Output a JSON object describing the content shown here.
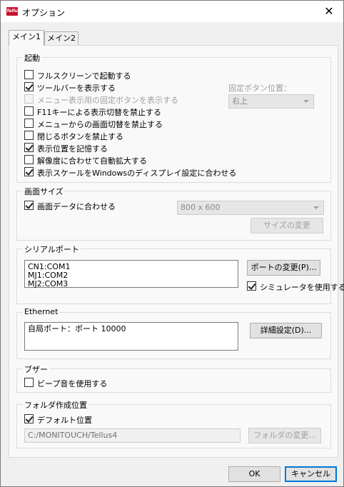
{
  "window": {
    "title": "オプション",
    "app_icon_text": "Tellus",
    "close_symbol": "✕"
  },
  "tabs": [
    {
      "label": "メイン1",
      "active": true
    },
    {
      "label": "メイン2",
      "active": false
    }
  ],
  "startup": {
    "title": "起動",
    "options": [
      {
        "label": "フルスクリーンで起動する",
        "checked": false,
        "disabled": false
      },
      {
        "label": "ツールバーを表示する",
        "checked": true,
        "disabled": false
      },
      {
        "label": "メニュー表示用の固定ボタンを表示する",
        "checked": false,
        "disabled": true
      },
      {
        "label": "F11キーによる表示切替を禁止する",
        "checked": false,
        "disabled": false
      },
      {
        "label": "メニューからの画面切替を禁止する",
        "checked": false,
        "disabled": false
      },
      {
        "label": "閉じるボタンを禁止する",
        "checked": false,
        "disabled": false
      },
      {
        "label": "表示位置を記憶する",
        "checked": true,
        "disabled": false
      },
      {
        "label": "解像度に合わせて自動拡大する",
        "checked": false,
        "disabled": false
      },
      {
        "label": "表示スケールをWindowsのディスプレイ設定に合わせる",
        "checked": true,
        "disabled": false
      }
    ],
    "fixed_button_position_label": "固定ボタン位置：",
    "fixed_button_position_value": "右上"
  },
  "screen_size": {
    "title": "画面サイズ",
    "fit_label": "画面データに合わせる",
    "fit_checked": true,
    "size_value": "800 x 600",
    "change_button": "サイズの変更"
  },
  "serial_port": {
    "title": "シリアルポート",
    "ports": [
      "CN1:COM1",
      "MJ1:COM2",
      "MJ2:COM3"
    ],
    "change_button": "ポートの変更(P)...",
    "simulator_label": "シミュレータを使用する",
    "simulator_checked": true
  },
  "ethernet": {
    "title": "Ethernet",
    "entries": [
      "自局ポート：ポート 10000"
    ],
    "details_button": "詳細設定(D)..."
  },
  "buzzer": {
    "title": "ブザー",
    "beep_label": "ビープ音を使用する",
    "beep_checked": false
  },
  "folder": {
    "title": "フォルダ作成位置",
    "default_label": "デフォルト位置",
    "default_checked": true,
    "path": "C:/MONITOUCH/Tellus4",
    "change_button": "フォルダの変更..."
  },
  "footer": {
    "ok": "OK",
    "cancel": "キャンセル"
  }
}
